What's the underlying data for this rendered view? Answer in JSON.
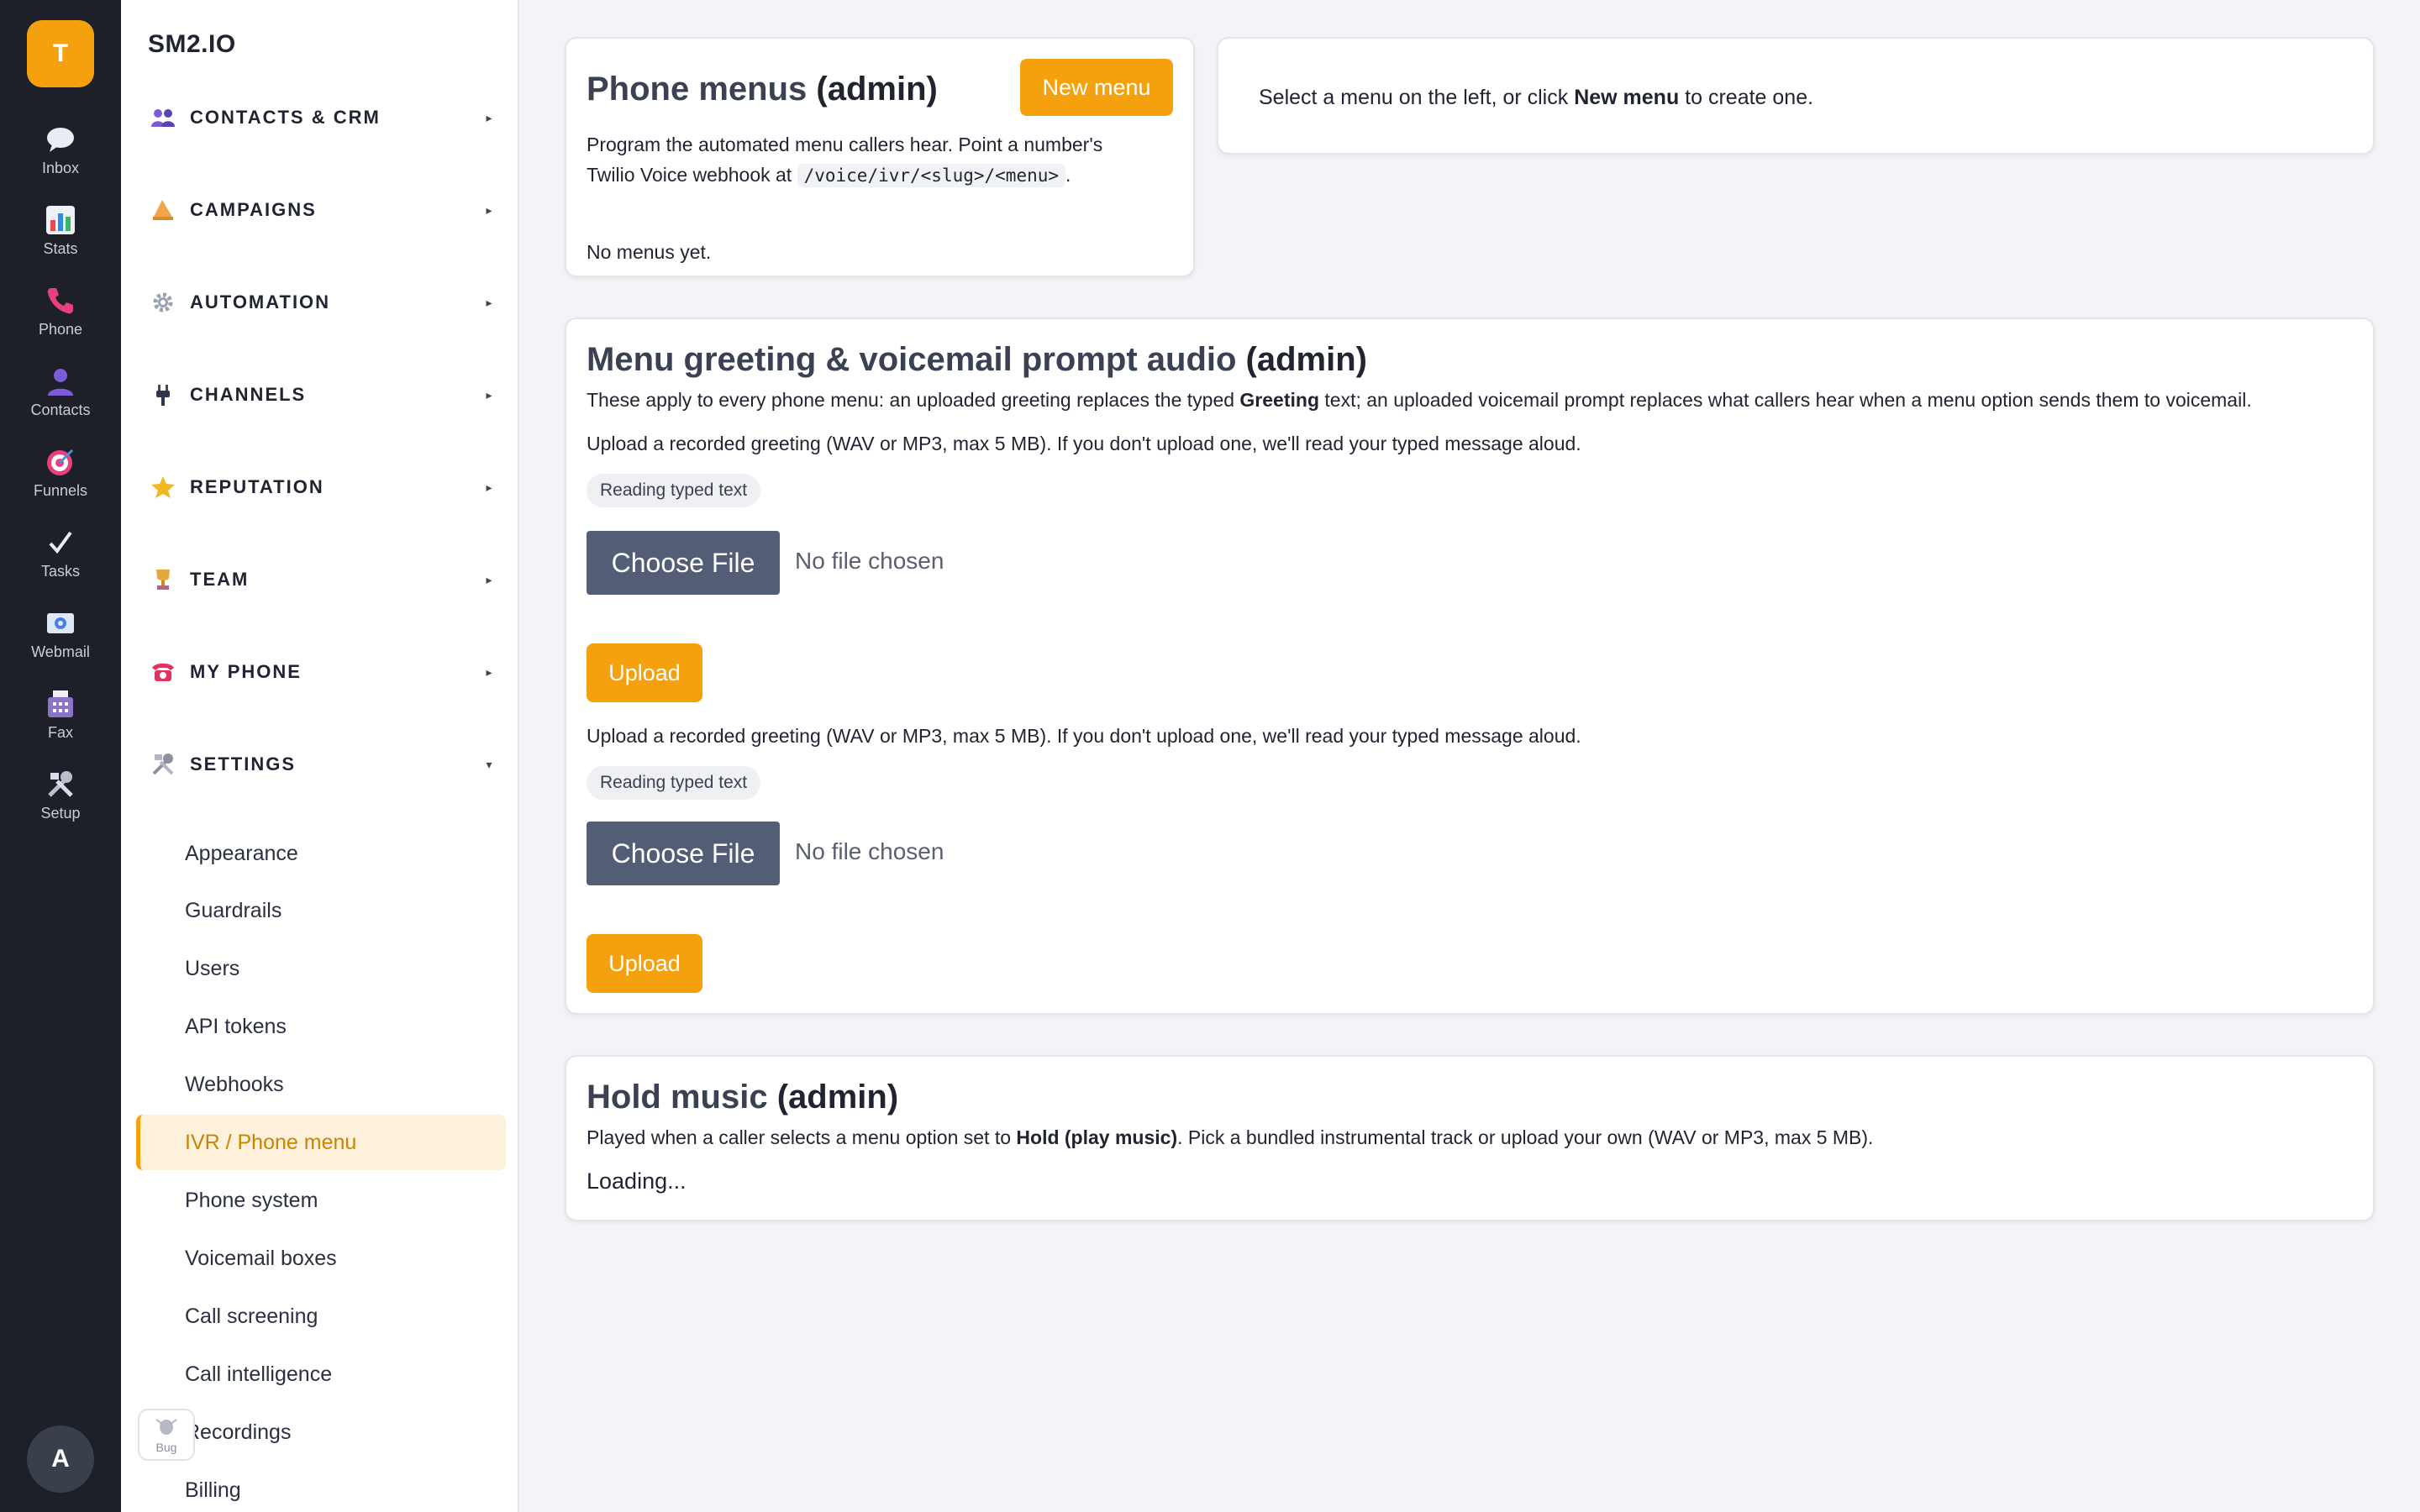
{
  "rail": {
    "logo": "T",
    "items": [
      {
        "label": "Inbox",
        "icon": "chat-bubble-icon"
      },
      {
        "label": "Stats",
        "icon": "bar-chart-icon"
      },
      {
        "label": "Phone",
        "icon": "phone-icon"
      },
      {
        "label": "Contacts",
        "icon": "person-icon"
      },
      {
        "label": "Funnels",
        "icon": "target-icon"
      },
      {
        "label": "Tasks",
        "icon": "checkmark-icon"
      },
      {
        "label": "Webmail",
        "icon": "mail-icon"
      },
      {
        "label": "Fax",
        "icon": "fax-icon"
      },
      {
        "label": "Setup",
        "icon": "tools-icon"
      }
    ],
    "avatar": "A"
  },
  "sidebar": {
    "brand": "SM2.IO",
    "sections": [
      {
        "label": "CONTACTS & CRM",
        "icon": "people-icon",
        "expanded": false
      },
      {
        "label": "CAMPAIGNS",
        "icon": "megaphone-icon",
        "expanded": false
      },
      {
        "label": "AUTOMATION",
        "icon": "gear-icon",
        "expanded": false
      },
      {
        "label": "CHANNELS",
        "icon": "plug-icon",
        "expanded": false
      },
      {
        "label": "REPUTATION",
        "icon": "star-icon",
        "expanded": false
      },
      {
        "label": "TEAM",
        "icon": "trophy-icon",
        "expanded": false
      },
      {
        "label": "MY PHONE",
        "icon": "telephone-icon",
        "expanded": false
      },
      {
        "label": "SETTINGS",
        "icon": "tools-icon",
        "expanded": true
      }
    ],
    "settings_items": [
      "Appearance",
      "Guardrails",
      "Users",
      "API tokens",
      "Webhooks",
      "IVR / Phone menu",
      "Phone system",
      "Voicemail boxes",
      "Call screening",
      "Call intelligence",
      "Recordings",
      "Billing"
    ],
    "active_item": "IVR / Phone menu",
    "bug_label": "Bug"
  },
  "menus_card": {
    "title": "Phone menus",
    "title_suffix": "(admin)",
    "new_button": "New menu",
    "desc_1": "Program the automated menu callers hear. Point a number's",
    "desc_2": "Twilio Voice webhook at",
    "code": "/voice/ivr/<slug>/<menu>",
    "desc_2_end": ".",
    "empty": "No menus yet."
  },
  "select_card": {
    "text_before": "Select a menu on the left, or click ",
    "text_bold": "New menu",
    "text_after": " to create one."
  },
  "audio_card": {
    "title": "Menu greeting & voicemail prompt audio",
    "title_suffix": "(admin)",
    "desc_before": "These apply to every phone menu: an uploaded greeting replaces the typed ",
    "desc_bold": "Greeting",
    "desc_after": " text; an uploaded voicemail prompt replaces what callers hear when a menu option sends them to voicemail.",
    "blocks": [
      {
        "instructions": "Upload a recorded greeting (WAV or MP3, max 5 MB). If you don't upload one, we'll read your typed message aloud.",
        "status": "Reading typed text",
        "choose_label": "Choose File",
        "no_file": "No file chosen",
        "upload_label": "Upload"
      },
      {
        "instructions": "Upload a recorded greeting (WAV or MP3, max 5 MB). If you don't upload one, we'll read your typed message aloud.",
        "status": "Reading typed text",
        "choose_label": "Choose File",
        "no_file": "No file chosen",
        "upload_label": "Upload"
      }
    ]
  },
  "hold_card": {
    "title": "Hold music",
    "title_suffix": "(admin)",
    "desc_before": "Played when a caller selects a menu option set to ",
    "desc_bold": "Hold (play music)",
    "desc_after": ". Pick a bundled instrumental track or upload your own (WAV or MP3, max 5 MB).",
    "loading": "Loading..."
  },
  "colors": {
    "accent": "#f5a10d",
    "rail_bg": "#1d2029",
    "file_button": "#535d76",
    "active_bg": "#fdf1dc"
  }
}
